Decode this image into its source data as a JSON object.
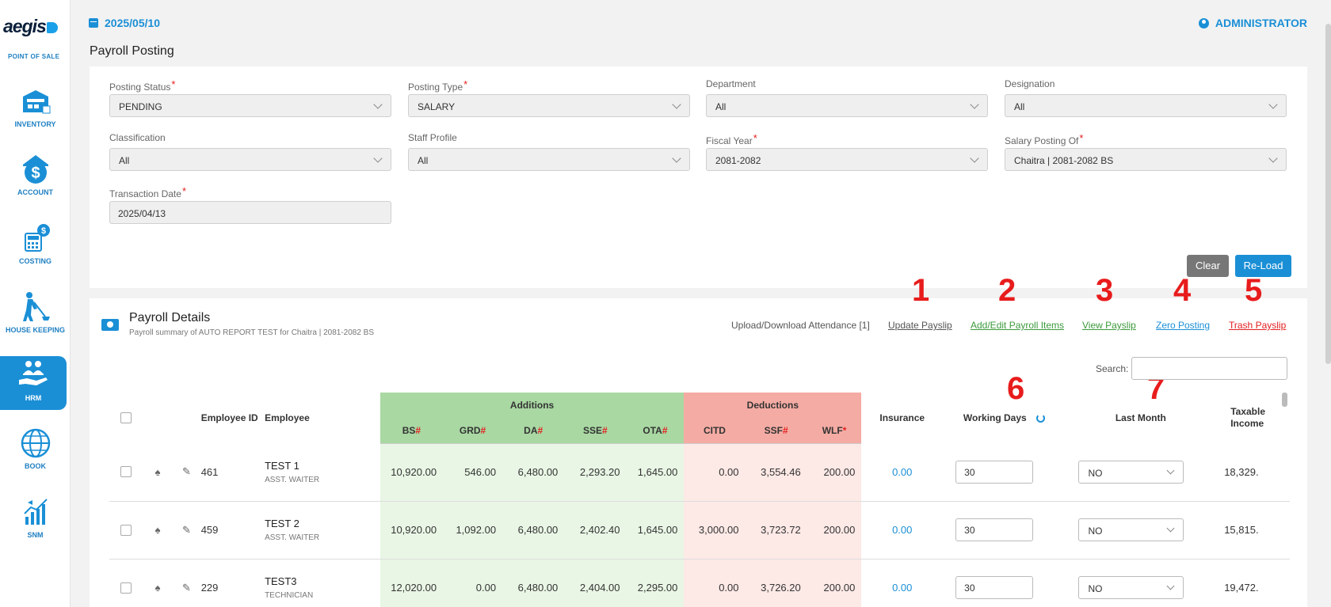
{
  "app": {
    "logo_text": "aegis",
    "logo_sub": "POINT OF SALE",
    "date": "2025/05/10",
    "user": "ADMINISTRATOR",
    "page_title": "Payroll Posting"
  },
  "sidebar": {
    "items": [
      {
        "label": "INVENTORY",
        "icon": "inventory-icon"
      },
      {
        "label": "ACCOUNT",
        "icon": "account-icon"
      },
      {
        "label": "COSTING",
        "icon": "costing-icon"
      },
      {
        "label": "HOUSE KEEPING",
        "icon": "housekeeping-icon"
      },
      {
        "label": "HRM",
        "icon": "hrm-icon",
        "active": true
      },
      {
        "label": "BOOK",
        "icon": "book-icon"
      },
      {
        "label": "SNM",
        "icon": "snm-icon"
      }
    ]
  },
  "filters": {
    "posting_status": {
      "label": "Posting Status",
      "value": "PENDING",
      "required": true
    },
    "posting_type": {
      "label": "Posting Type",
      "value": "SALARY",
      "required": true
    },
    "department": {
      "label": "Department",
      "value": "All"
    },
    "designation": {
      "label": "Designation",
      "value": "All"
    },
    "classification": {
      "label": "Classification",
      "value": "All"
    },
    "staff_profile": {
      "label": "Staff Profile",
      "value": "All"
    },
    "fiscal_year": {
      "label": "Fiscal Year",
      "value": "2081-2082",
      "required": true
    },
    "salary_posting_of": {
      "label": "Salary Posting Of",
      "value": "Chaitra | 2081-2082 BS",
      "required": true
    },
    "transaction_date": {
      "label": "Transaction Date",
      "value": "2025/04/13",
      "required": true
    },
    "required_mark": "*",
    "clear_label": "Clear",
    "reload_label": "Re-Load"
  },
  "details": {
    "title": "Payroll Details",
    "subtitle": "Payroll summary of AUTO REPORT TEST for Chaitra | 2081-2082 BS",
    "actions": {
      "upload_download": "Upload/Download Attendance [1]",
      "update_payslip": "Update Payslip",
      "add_edit_items": "Add/Edit Payroll Items",
      "view_payslip": "View Payslip",
      "zero_posting": "Zero Posting",
      "trash_payslip": "Trash Payslip"
    },
    "annotations": [
      "1",
      "2",
      "3",
      "4",
      "5",
      "6",
      "7"
    ],
    "search_label": "Search:",
    "search_value": ""
  },
  "colors": {
    "accent": "#1a8fd6",
    "additions_header": "#a9d8a2",
    "deductions_header": "#f4aba3",
    "annotation": "#e81c1c",
    "update_link": "#555555",
    "add_edit_link": "#3c9a3c",
    "view_link": "#3c9a3c",
    "zero_link": "#1a8fd6",
    "trash_link": "#e32020"
  },
  "table": {
    "headers": {
      "employee_id": "Employee ID",
      "employee": "Employee",
      "additions": "Additions",
      "deductions": "Deductions",
      "insurance": "Insurance",
      "working_days": "Working Days",
      "last_month": "Last Month",
      "taxable_income": "Taxable Income",
      "bs": "BS",
      "grd": "GRD",
      "da": "DA",
      "sse": "SSE",
      "ota": "OTA",
      "citd": "CITD",
      "ssf": "SSF",
      "wlf": "WLF",
      "hash_mark": "#",
      "star_mark": "*"
    },
    "rows": [
      {
        "id": "461",
        "name": "TEST 1",
        "role": "ASST. WAITER",
        "bs": "10,920.00",
        "grd": "546.00",
        "da": "6,480.00",
        "sse": "2,293.20",
        "ota": "1,645.00",
        "citd": "0.00",
        "ssf": "3,554.46",
        "wlf": "200.00",
        "insurance": "0.00",
        "working_days": "30",
        "last_month": "NO",
        "taxable": "18,329."
      },
      {
        "id": "459",
        "name": "TEST 2",
        "role": "ASST. WAITER",
        "bs": "10,920.00",
        "grd": "1,092.00",
        "da": "6,480.00",
        "sse": "2,402.40",
        "ota": "1,645.00",
        "citd": "3,000.00",
        "ssf": "3,723.72",
        "wlf": "200.00",
        "insurance": "0.00",
        "working_days": "30",
        "last_month": "NO",
        "taxable": "15,815."
      },
      {
        "id": "229",
        "name": "TEST3",
        "role": "TECHNICIAN",
        "bs": "12,020.00",
        "grd": "0.00",
        "da": "6,480.00",
        "sse": "2,404.00",
        "ota": "2,295.00",
        "citd": "0.00",
        "ssf": "3,726.20",
        "wlf": "200.00",
        "insurance": "0.00",
        "working_days": "30",
        "last_month": "NO",
        "taxable": "19,472."
      }
    ]
  }
}
